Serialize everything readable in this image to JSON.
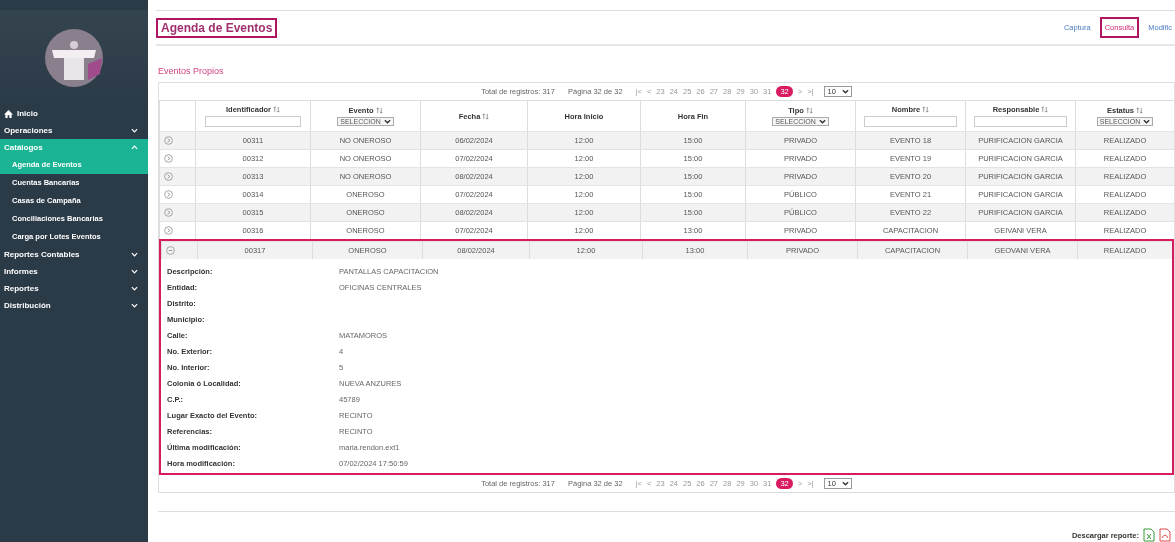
{
  "sidebar": {
    "items": [
      {
        "label": "Inicio",
        "kind": "home",
        "selected": false
      },
      {
        "label": "Operaciones",
        "kind": "group",
        "expanded": false,
        "selected": false
      },
      {
        "label": "Catálogos",
        "kind": "group",
        "expanded": true,
        "selected": true,
        "children": [
          {
            "label": "Agenda de Eventos",
            "selected": true
          },
          {
            "label": "Cuentas Bancarias",
            "selected": false
          },
          {
            "label": "Casas de Campaña",
            "selected": false
          },
          {
            "label": "Conciliaciones Bancarias",
            "selected": false
          },
          {
            "label": "Carga por Lotes Eventos",
            "selected": false
          }
        ]
      },
      {
        "label": "Reportes Contables",
        "kind": "group",
        "expanded": false,
        "selected": false
      },
      {
        "label": "Informes",
        "kind": "group",
        "expanded": false,
        "selected": false
      },
      {
        "label": "Reportes",
        "kind": "group",
        "expanded": false,
        "selected": false
      },
      {
        "label": "Distribución",
        "kind": "group",
        "expanded": false,
        "selected": false
      }
    ]
  },
  "page": {
    "title": "Agenda de Eventos",
    "actions": [
      {
        "label": "Captura",
        "selected": false
      },
      {
        "label": "Consulta",
        "selected": true
      },
      {
        "label": "Modific",
        "selected": false
      }
    ]
  },
  "section_title": "Eventos Propios",
  "pagination_top": {
    "total": "Total de registros: 317",
    "page_info": "Página 32 de 32",
    "first": "|<",
    "prev": "<",
    "pages": [
      {
        "label": "23",
        "selected": false
      },
      {
        "label": "24",
        "selected": false
      },
      {
        "label": "25",
        "selected": false
      },
      {
        "label": "26",
        "selected": false
      },
      {
        "label": "27",
        "selected": false
      },
      {
        "label": "28",
        "selected": false
      },
      {
        "label": "29",
        "selected": false
      },
      {
        "label": "30",
        "selected": false
      },
      {
        "label": "31",
        "selected": false
      },
      {
        "label": "32",
        "selected": true
      }
    ],
    "next": ">",
    "last": ">|",
    "page_size": "10"
  },
  "table": {
    "columns": [
      {
        "label": "Identificador",
        "sortable": true,
        "kind": "text"
      },
      {
        "label": "Evento",
        "sortable": true,
        "kind": "select",
        "filter_value": "SELECCION"
      },
      {
        "label": "Fecha",
        "sortable": true,
        "kind": "plain"
      },
      {
        "label": "Hora Inicio",
        "sortable": false,
        "kind": "plain"
      },
      {
        "label": "Hora Fin",
        "sortable": false,
        "kind": "plain"
      },
      {
        "label": "Tipo",
        "sortable": true,
        "kind": "select",
        "filter_value": "SELECCION"
      },
      {
        "label": "Nombre",
        "sortable": true,
        "kind": "text"
      },
      {
        "label": "Responsable",
        "sortable": true,
        "kind": "text"
      },
      {
        "label": "Estatus",
        "sortable": true,
        "kind": "select",
        "filter_value": "SELECCION"
      }
    ],
    "rows": [
      {
        "expanded": false,
        "cells": [
          "00311",
          "NO ONEROSO",
          "06/02/2024",
          "12:00",
          "15:00",
          "PRIVADO",
          "EVENTO 18",
          "PURIFICACION GARCIA",
          "REALIZADO"
        ]
      },
      {
        "expanded": false,
        "cells": [
          "00312",
          "NO ONEROSO",
          "07/02/2024",
          "12:00",
          "15:00",
          "PRIVADO",
          "EVENTO 19",
          "PURIFICACION GARCIA",
          "REALIZADO"
        ]
      },
      {
        "expanded": false,
        "cells": [
          "00313",
          "NO ONEROSO",
          "08/02/2024",
          "12:00",
          "15:00",
          "PRIVADO",
          "EVENTO 20",
          "PURIFICACION GARCIA",
          "REALIZADO"
        ]
      },
      {
        "expanded": false,
        "cells": [
          "00314",
          "ONEROSO",
          "07/02/2024",
          "12:00",
          "15:00",
          "PÚBLICO",
          "EVENTO 21",
          "PURIFICACION GARCIA",
          "REALIZADO"
        ]
      },
      {
        "expanded": false,
        "cells": [
          "00315",
          "ONEROSO",
          "08/02/2024",
          "12:00",
          "15:00",
          "PÚBLICO",
          "EVENTO 22",
          "PURIFICACION GARCIA",
          "REALIZADO"
        ]
      },
      {
        "expanded": false,
        "cells": [
          "00316",
          "ONEROSO",
          "07/02/2024",
          "12:00",
          "13:00",
          "PRIVADO",
          "CAPACITACION",
          "GEIVANI VERA",
          "REALIZADO"
        ]
      },
      {
        "expanded": true,
        "cells": [
          "00317",
          "ONEROSO",
          "08/02/2024",
          "12:00",
          "13:00",
          "PRIVADO",
          "CAPACITACION",
          "GEOVANI VERA",
          "REALIZADO"
        ],
        "details": [
          {
            "label": "Descripción:",
            "value": "PANTALLAS CAPACITACION"
          },
          {
            "label": "Entidad:",
            "value": "OFICINAS CENTRALES"
          },
          {
            "label": "Distrito:"
          },
          {
            "label": "Municipio:"
          },
          {
            "label": "Calle:",
            "value": "MATAMOROS"
          },
          {
            "label": "No. Exterior:",
            "value": "4"
          },
          {
            "label": "No. Interior:",
            "value": "5"
          },
          {
            "label": "Colonia ó Localidad:",
            "value": "NUEVA ANZURES"
          },
          {
            "label": "C.P.:",
            "value": "45789"
          },
          {
            "label": "Lugar Exacto del Evento:",
            "value": "RECINTO"
          },
          {
            "label": "Referencias:",
            "value": "RECINTO"
          },
          {
            "label": "Última modificación:",
            "value": "maria.rendon.ext1"
          },
          {
            "label": "Hora modificación:",
            "value": "07/02/2024 17:50:59"
          }
        ]
      }
    ]
  },
  "pagination_bottom": {
    "total": "Total de registros: 317",
    "page_info": "Página 32 de 32",
    "first": "|<",
    "prev": "<",
    "pages": [
      {
        "label": "23",
        "selected": false
      },
      {
        "label": "24",
        "selected": false
      },
      {
        "label": "25",
        "selected": false
      },
      {
        "label": "26",
        "selected": false
      },
      {
        "label": "27",
        "selected": false
      },
      {
        "label": "28",
        "selected": false
      },
      {
        "label": "29",
        "selected": false
      },
      {
        "label": "30",
        "selected": false
      },
      {
        "label": "31",
        "selected": false
      },
      {
        "label": "32",
        "selected": true
      }
    ],
    "next": ">",
    "last": ">|",
    "page_size": "10"
  },
  "download": {
    "label": "Descargar reporte:"
  }
}
